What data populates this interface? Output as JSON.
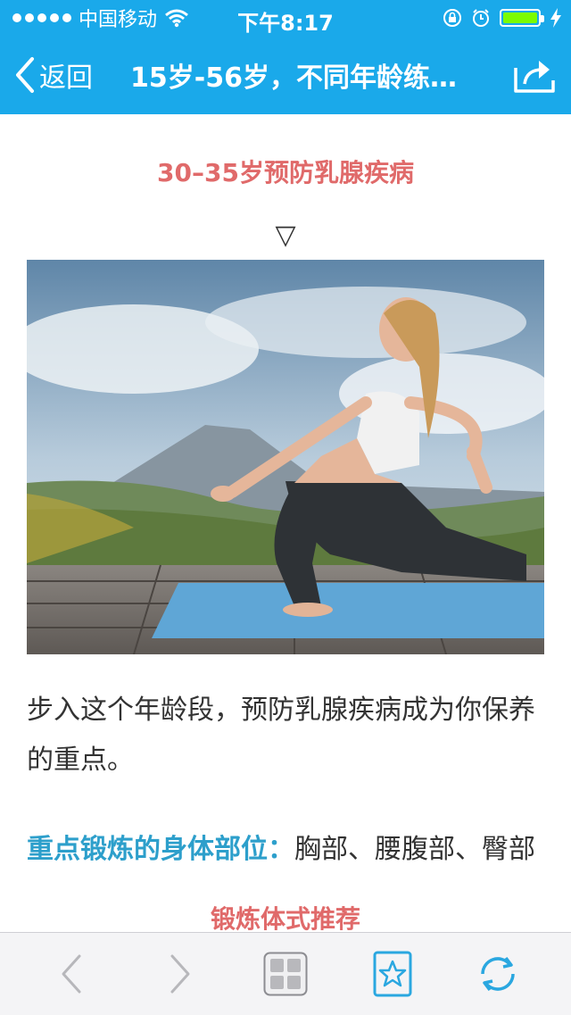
{
  "status_bar": {
    "carrier": "中国移动",
    "time": "下午8:17"
  },
  "nav": {
    "back_label": "返回",
    "title": "15岁-56岁，不同年龄练…"
  },
  "article": {
    "section_title": "30–35岁预防乳腺疾病",
    "down_marker": "▽",
    "paragraph": "步入这个年龄段，预防乳腺疾病成为你保养的重点。",
    "focus_label": "重点锻炼的身体部位：",
    "focus_value": "胸部、腰腹部、臀部",
    "recommend_title": "锻炼体式推荐"
  },
  "colors": {
    "nav_bg": "#1aa9ea",
    "section_title": "#e06a6a",
    "focus_label": "#2d9fcb",
    "toolbar_icon": "#2aa7e0"
  }
}
